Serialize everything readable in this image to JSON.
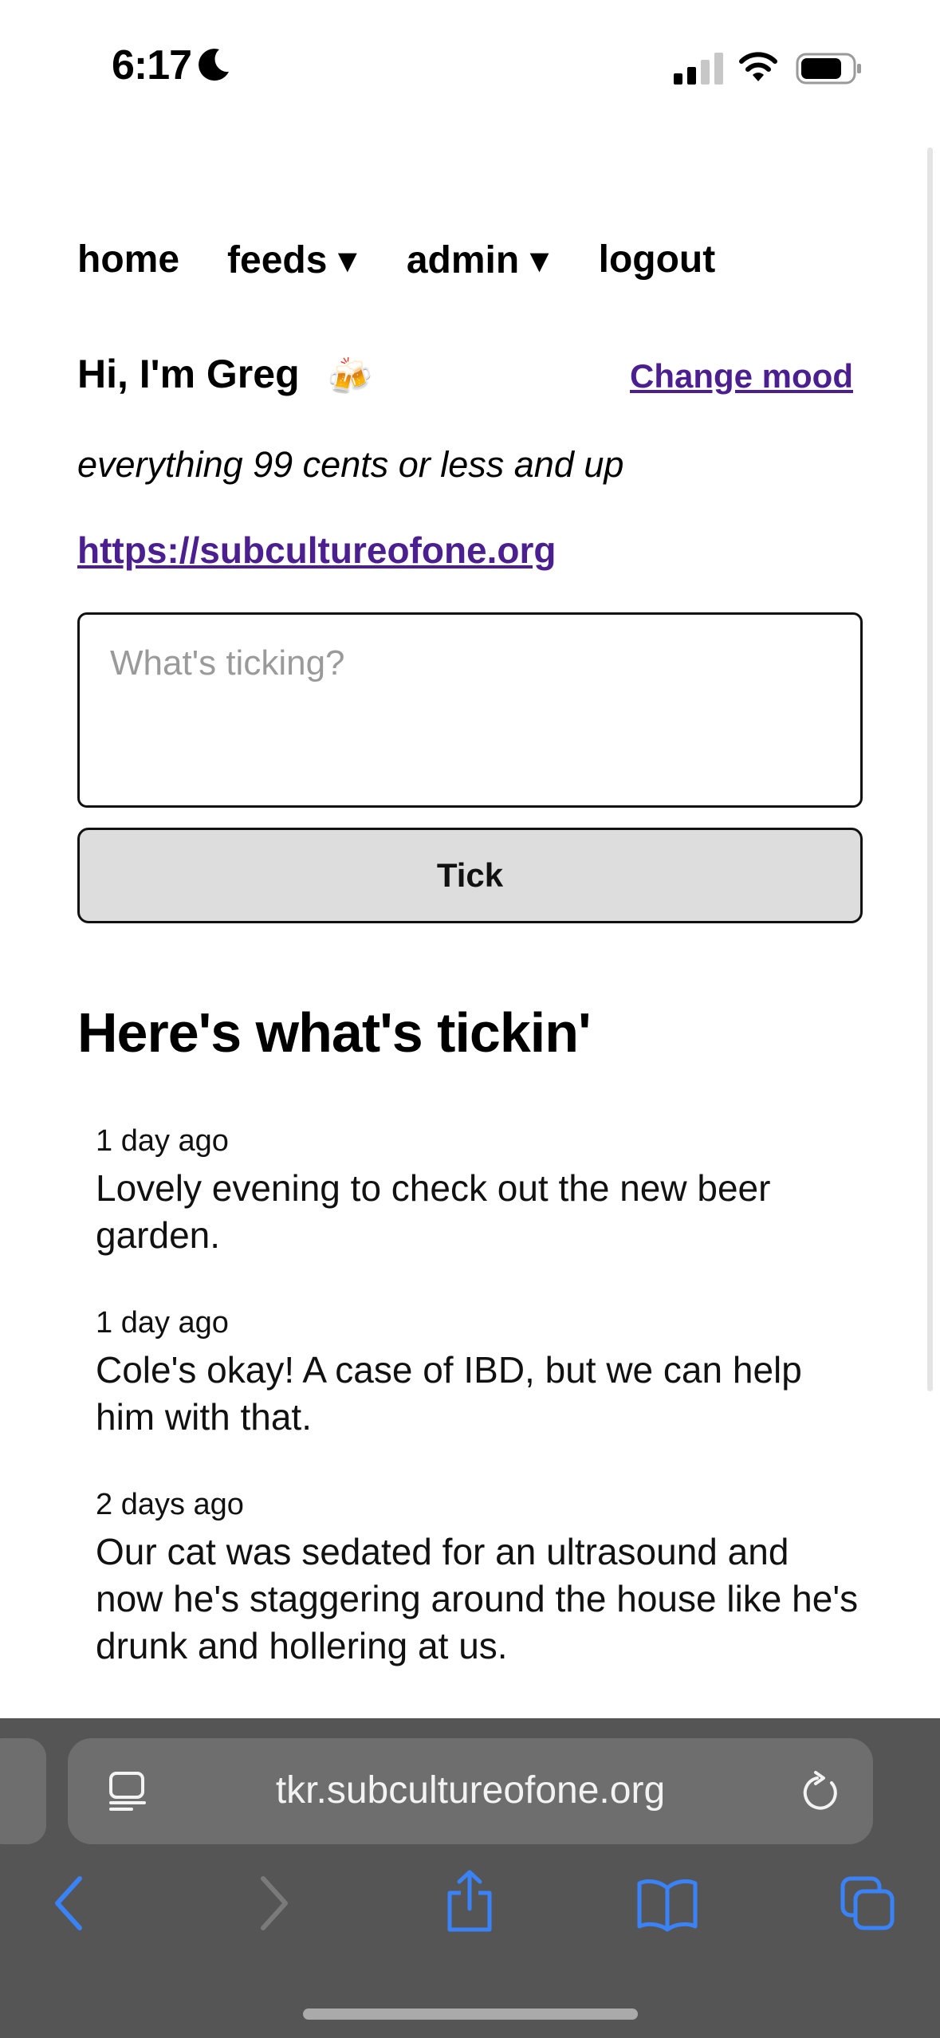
{
  "status_bar": {
    "time": "6:17"
  },
  "nav": {
    "home": "home",
    "feeds": "feeds ▾",
    "admin": "admin ▾",
    "logout": "logout"
  },
  "profile": {
    "greeting": "Hi, I'm Greg",
    "mood_emoji": "🍻",
    "change_mood": "Change mood",
    "tagline": "everything 99 cents or less and up",
    "website": "https://subcultureofone.org"
  },
  "composer": {
    "placeholder": "What's ticking?",
    "value": "",
    "submit_label": "Tick"
  },
  "feed": {
    "title": "Here's what's tickin'",
    "items": [
      {
        "time": "1 day ago",
        "text": "Lovely evening to check out the new beer garden."
      },
      {
        "time": "1 day ago",
        "text": "Cole's okay! A case of IBD, but we can help him with that."
      },
      {
        "time": "2 days ago",
        "text": "Our cat was sedated for an ultrasound and now he's staggering around the house like he's drunk and hollering at us."
      }
    ]
  },
  "browser": {
    "url": "tkr.subcultureofone.org"
  },
  "colors": {
    "link": "#4b1f8f",
    "chrome_bg": "#555555",
    "address_bar_bg": "#6e6e6e",
    "toolbar_accent": "#3a82f7",
    "button_bg": "#dddddd"
  },
  "icons": [
    "moon-icon",
    "cellular-signal-icon",
    "wifi-icon",
    "battery-icon",
    "reader-icon",
    "reload-icon",
    "back-icon",
    "forward-icon",
    "share-icon",
    "bookmarks-icon",
    "tabs-icon"
  ]
}
